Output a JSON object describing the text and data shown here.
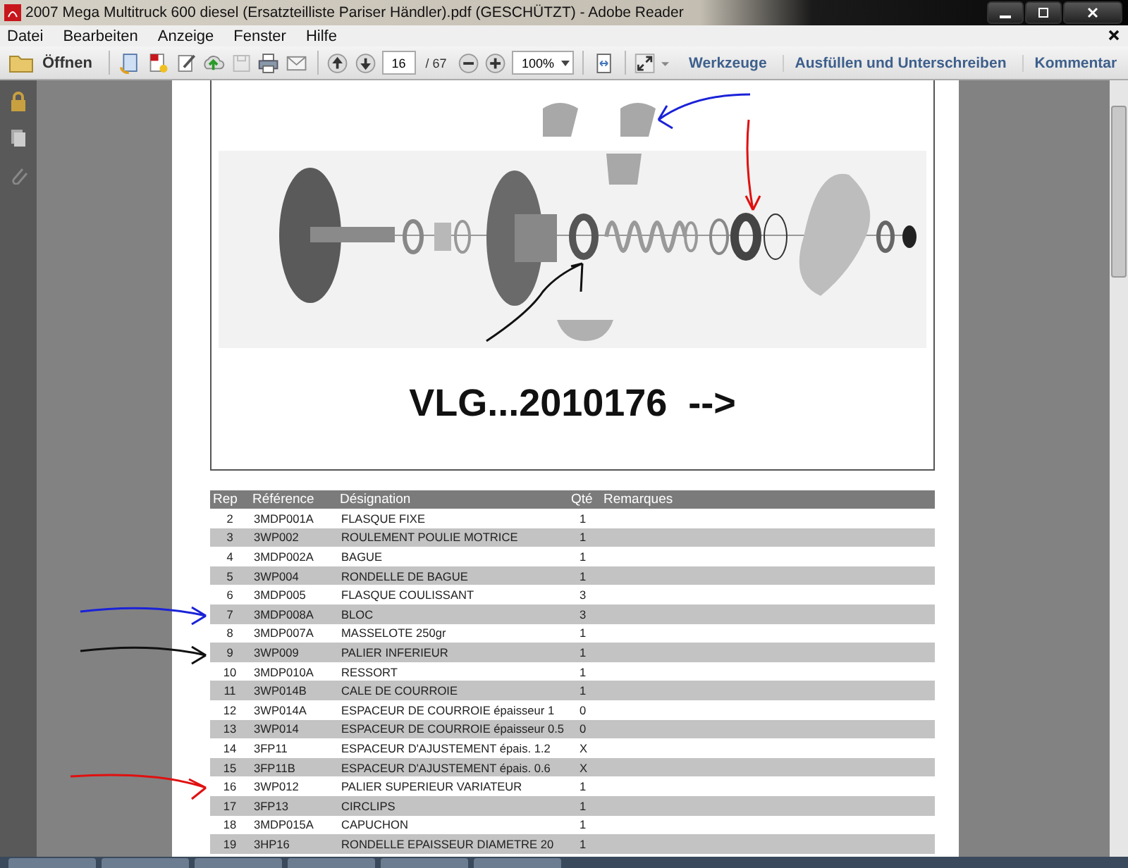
{
  "window": {
    "title": "2007 Mega Multitruck 600 diesel (Ersatzteilliste Pariser Händler).pdf (GESCHÜTZT) - Adobe Reader"
  },
  "menu": [
    "Datei",
    "Bearbeiten",
    "Anzeige",
    "Fenster",
    "Hilfe"
  ],
  "toolbar": {
    "open_label": "Öffnen",
    "page_number": "16",
    "page_count": "/ 67",
    "zoom": "100%",
    "panes": [
      "Werkzeuge",
      "Ausfüllen und Unterschreiben",
      "Kommentar"
    ]
  },
  "document": {
    "caption": "VLG...2010176  -->",
    "table": {
      "columns": [
        "Rep",
        "Référence",
        "Désignation",
        "Qté",
        "Remarques"
      ],
      "rows": [
        [
          "2",
          "3MDP001A",
          "FLASQUE FIXE",
          "1"
        ],
        [
          "3",
          "3WP002",
          "ROULEMENT POULIE MOTRICE",
          "1"
        ],
        [
          "4",
          "3MDP002A",
          "BAGUE",
          "1"
        ],
        [
          "5",
          "3WP004",
          "RONDELLE DE BAGUE",
          "1"
        ],
        [
          "6",
          "3MDP005",
          "FLASQUE COULISSANT",
          "3"
        ],
        [
          "7",
          "3MDP008A",
          "BLOC",
          "3"
        ],
        [
          "8",
          "3MDP007A",
          "MASSELOTE 250gr",
          "1"
        ],
        [
          "9",
          "3WP009",
          "PALIER INFERIEUR",
          "1"
        ],
        [
          "10",
          "3MDP010A",
          "RESSORT",
          "1"
        ],
        [
          "11",
          "3WP014B",
          "CALE DE COURROIE",
          "1"
        ],
        [
          "12",
          "3WP014A",
          "ESPACEUR DE COURROIE épaisseur 1",
          "0"
        ],
        [
          "13",
          "3WP014",
          "ESPACEUR DE COURROIE épaisseur 0.5",
          "0"
        ],
        [
          "14",
          "3FP11",
          "ESPACEUR D'AJUSTEMENT épais. 1.2",
          "X"
        ],
        [
          "15",
          "3FP11B",
          "ESPACEUR D'AJUSTEMENT épais. 0.6",
          "X"
        ],
        [
          "16",
          "3WP012",
          "PALIER SUPERIEUR VARIATEUR",
          "1"
        ],
        [
          "17",
          "3FP13",
          "CIRCLIPS",
          "1"
        ],
        [
          "18",
          "3MDP015A",
          "CAPUCHON",
          "1"
        ],
        [
          "19",
          "3HP16",
          "RONDELLE EPAISSEUR DIAMETRE 20",
          "1"
        ]
      ]
    }
  }
}
